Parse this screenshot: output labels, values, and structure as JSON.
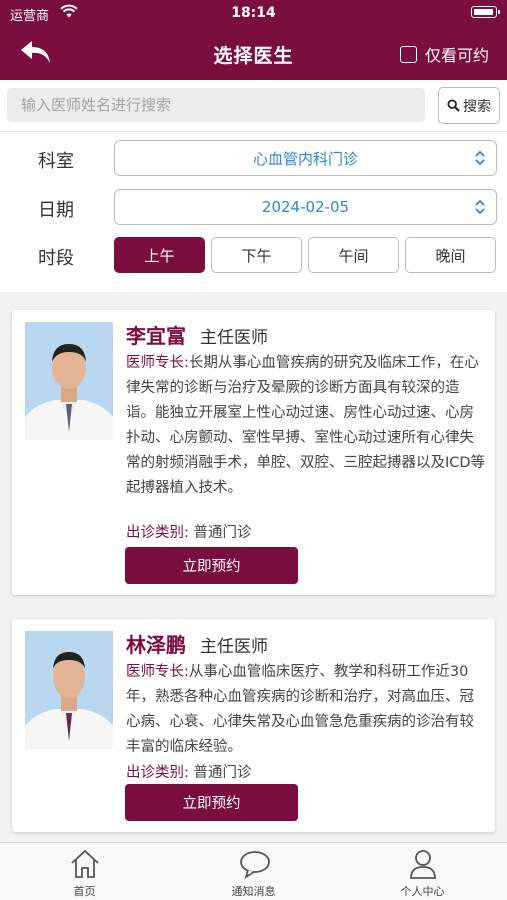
{
  "status": {
    "carrier": "运营商",
    "time": "18:14"
  },
  "nav": {
    "title": "选择医生",
    "only_available_label": "仅看可约"
  },
  "search": {
    "placeholder": "输入医师姓名进行搜索",
    "button_label": "搜索"
  },
  "filters": {
    "department_label": "科室",
    "department_value": "心血管内科门诊",
    "date_label": "日期",
    "date_value": "2024-02-05",
    "period_label": "时段",
    "periods": [
      "上午",
      "下午",
      "午间",
      "晚间"
    ],
    "active_period": "上午"
  },
  "doctors": [
    {
      "name": "李宜富",
      "rank": "主任医师",
      "specialty_key": "医师专长:",
      "specialty": "长期从事心血管疾病的研究及临床工作，在心律失常的诊断与治疗及晕厥的诊断方面具有较深的造诣。能独立开展室上性心动过速、房性心动过速、心房扑动、心房颤动、室性早搏、室性心动过速所有心律失常的射频消融手术，单腔、双腔、三腔起搏器以及ICD等起搏器植入技术。",
      "type_key": "出诊类别:",
      "type": "普通门诊",
      "book_label": "立即预约"
    },
    {
      "name": "林泽鹏",
      "rank": "主任医师",
      "specialty_key": "医师专长:",
      "specialty": "从事心血管临床医疗、教学和科研工作近30年，熟悉各种心血管疾病的诊断和治疗，对高血压、冠心病、心衰、心律失常及心血管急危重疾病的诊治有较丰富的临床经验。",
      "type_key": "出诊类别:",
      "type": "普通门诊",
      "book_label": "立即预约"
    }
  ],
  "tabbar": {
    "items": [
      "首页",
      "通知消息",
      "个人中心"
    ]
  },
  "colors": {
    "primary": "#7a0e3f",
    "link": "#2f86d6"
  }
}
